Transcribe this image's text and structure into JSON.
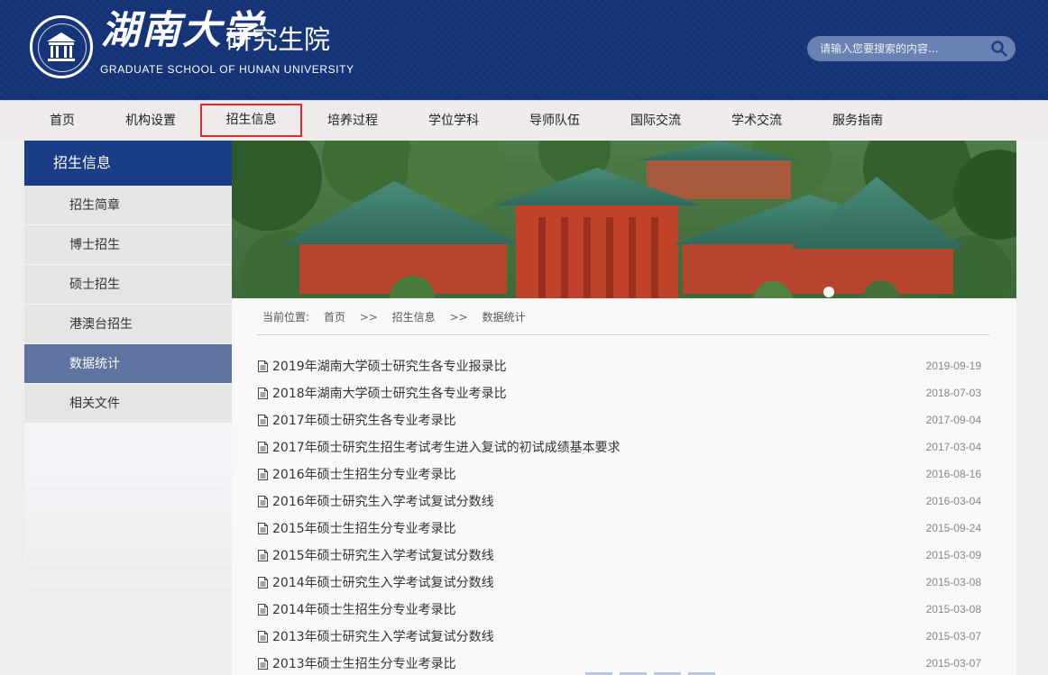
{
  "header": {
    "brand": "湖南大学",
    "subtitle": "研究生院",
    "english": "GRADUATE SCHOOL OF HUNAN UNIVERSITY",
    "search_placeholder": "请输入您要搜索的内容...",
    "search_icon": "search-icon"
  },
  "nav": {
    "items": [
      {
        "label": "首页"
      },
      {
        "label": "机构设置"
      },
      {
        "label": "招生信息",
        "active": true
      },
      {
        "label": "培养过程"
      },
      {
        "label": "学位学科"
      },
      {
        "label": "导师队伍"
      },
      {
        "label": "国际交流"
      },
      {
        "label": "学术交流"
      },
      {
        "label": "服务指南"
      }
    ]
  },
  "sidebar": {
    "title": "招生信息",
    "items": [
      {
        "label": "招生简章"
      },
      {
        "label": "博士招生"
      },
      {
        "label": "硕士招生"
      },
      {
        "label": "港澳台招生"
      },
      {
        "label": "数据统计",
        "active": true
      },
      {
        "label": "相关文件"
      }
    ]
  },
  "breadcrumb": {
    "prefix": "当前位置:",
    "items": [
      "首页",
      "招生信息",
      "数据统计"
    ],
    "separator": ">>"
  },
  "articles": [
    {
      "title": "2019年湖南大学硕士研究生各专业报录比",
      "date": "2019-09-19"
    },
    {
      "title": "2018年湖南大学硕士研究生各专业考录比",
      "date": "2018-07-03"
    },
    {
      "title": "2017年硕士研究生各专业考录比",
      "date": "2017-09-04"
    },
    {
      "title": "2017年硕士研究生招生考试考生进入复试的初试成绩基本要求",
      "date": "2017-03-04"
    },
    {
      "title": "2016年硕士生招生分专业考录比",
      "date": "2016-08-16"
    },
    {
      "title": "2016年硕士研究生入学考试复试分数线",
      "date": "2016-03-04"
    },
    {
      "title": "2015年硕士生招生分专业考录比",
      "date": "2015-09-24"
    },
    {
      "title": "2015年硕士研究生入学考试复试分数线",
      "date": "2015-03-09"
    },
    {
      "title": "2014年硕士研究生入学考试复试分数线",
      "date": "2015-03-08"
    },
    {
      "title": "2014年硕士生招生分专业考录比",
      "date": "2015-03-08"
    },
    {
      "title": "2013年硕士研究生入学考试复试分数线",
      "date": "2015-03-07"
    },
    {
      "title": "2013年硕士生招生分专业考录比",
      "date": "2015-03-07"
    }
  ],
  "colors": {
    "header_bg": "#15347a",
    "sidebar_head": "#1b3c86",
    "sidebar_active": "#5f73a0",
    "nav_highlight": "#e2282b"
  }
}
